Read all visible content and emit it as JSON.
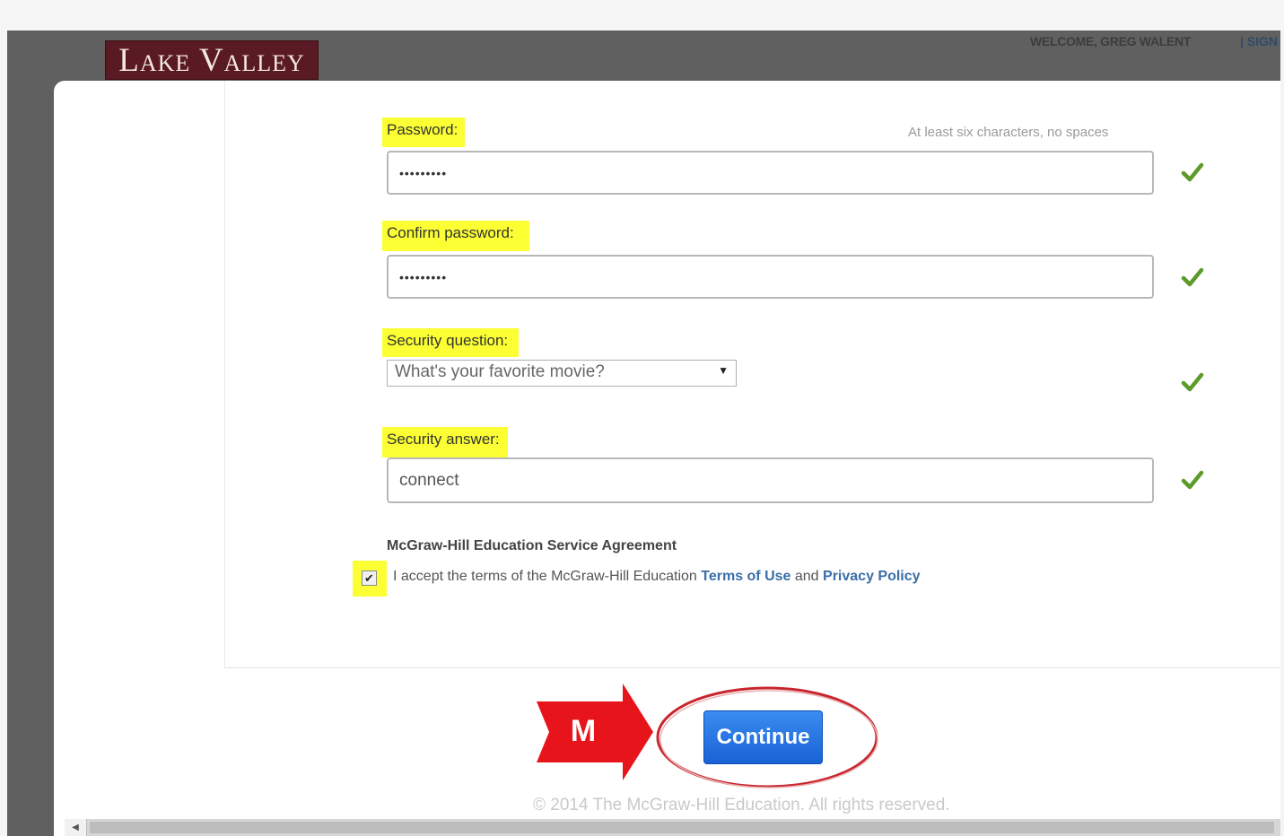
{
  "header": {
    "logo_text": "Lake Valley",
    "welcome_text": "WELCOME, GREG WALENT",
    "sign_link": "| SIGN"
  },
  "form": {
    "password": {
      "label": "Password:",
      "hint": "At least six characters, no spaces",
      "value": "•••••••••"
    },
    "confirm_password": {
      "label": "Confirm password:",
      "value": "•••••••••"
    },
    "security_question": {
      "label": "Security question:",
      "selected": "What's your favorite movie?"
    },
    "security_answer": {
      "label": "Security answer:",
      "value": "connect"
    },
    "agreement": {
      "title": "McGraw-Hill Education Service Agreement",
      "accept_prefix": "I accept the terms of the McGraw-Hill Education ",
      "terms_link": "Terms of Use",
      "and_text": " and ",
      "privacy_link": "Privacy Policy",
      "checked": true
    }
  },
  "annotation": {
    "marker_letter": "M",
    "arrow_color": "#e8141b",
    "circle_color": "#c8262c",
    "highlight_color": "#fbff33"
  },
  "actions": {
    "continue_label": "Continue"
  },
  "footer": {
    "copyright": "© 2014 The McGraw-Hill Education. All rights reserved."
  },
  "icons": {
    "valid": "checkmark-icon",
    "dropdown": "caret-down-icon",
    "scroll_left": "chevron-left-icon"
  },
  "colors": {
    "valid_check": "#5c9a2a",
    "button": "#1e6fe0",
    "logo_bg": "#5a1a24"
  }
}
